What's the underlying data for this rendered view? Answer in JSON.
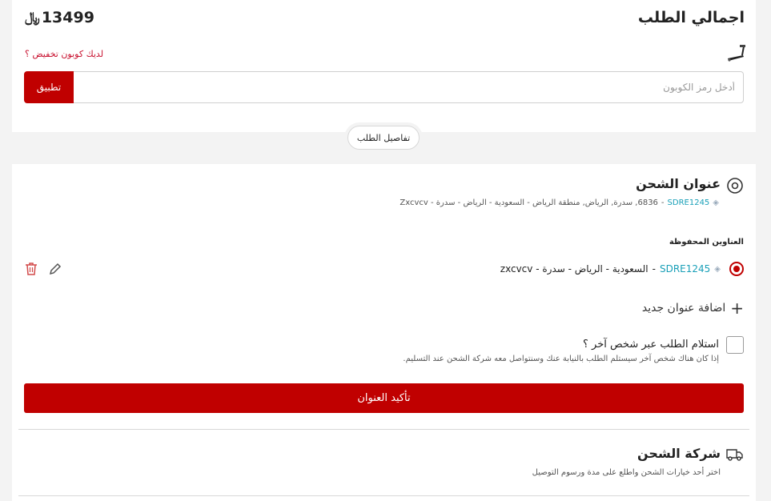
{
  "order_summary": {
    "title": "اجمالي الطلب",
    "total_amount": "13499",
    "currency_symbol": "﷼",
    "coupon_question": "لديك كوبون تخفيض ؟",
    "coupon_placeholder": "أدخل رمز الكوبون",
    "apply_label": "تطبيق",
    "details_label": "تفاصيل الطلب"
  },
  "shipping_address": {
    "title": "عنوان الشحن",
    "current_code": "SDRE1245",
    "current_address": "6836, سدرة, الرياض, منطقة الرياض - السعودية - الرياض - سدرة - Zxcvcv",
    "saved_heading": "العناوين المحفوظة",
    "saved_items": [
      {
        "code": "SDRE1245",
        "address": "السعودية - الرياض - سدرة - zxcvcv"
      }
    ],
    "add_new_label": "اضافة عنوان جديد",
    "pickup_other_label": "استلام الطلب عبر شخص آخر ؟",
    "pickup_other_desc": "إذا كان هناك شخص آخر سيستلم الطلب بالنيابة عنك وسنتواصل معه شركة الشحن عند التسليم.",
    "confirm_label": "تأكيد العنوان"
  },
  "shipping_company": {
    "title": "شركة الشحن",
    "subtitle": "اختر أحد خيارات الشحن واطلع على مدة ورسوم التوصيل"
  },
  "colors": {
    "accent": "#c00000",
    "link_red": "#c8102e",
    "teal": "#1aa0b8"
  },
  "icons": [
    "treadmill-icon",
    "location-pin-icon",
    "diamond-icon",
    "edit-pencil-icon",
    "trash-icon",
    "plus-icon",
    "delivery-truck-icon"
  ]
}
